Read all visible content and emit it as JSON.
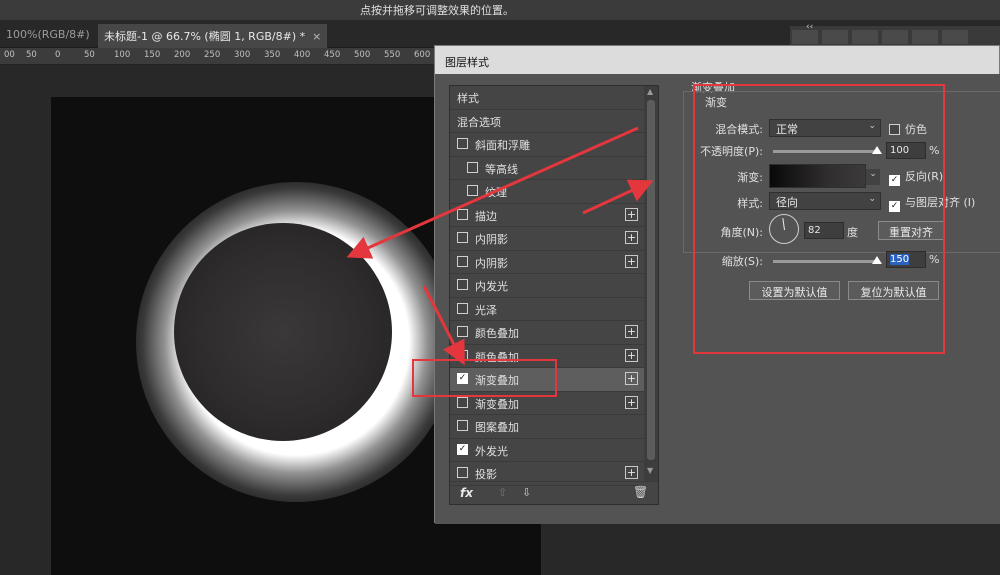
{
  "hint": "点按并拖移可调整效果的位置。",
  "panel_collapse_glyph": "‹‹",
  "tabs": [
    {
      "label": "100%(RGB/8#)",
      "close": "×"
    },
    {
      "label": "未标题-1 @ 66.7% (椭圆 1, RGB/8#) *",
      "close": "×"
    }
  ],
  "ruler": [
    "00",
    "50",
    "0",
    "50",
    "100",
    "150",
    "200",
    "250",
    "300",
    "350",
    "400",
    "450",
    "500",
    "550",
    "600",
    "650"
  ],
  "dialog": {
    "title": "图层样式",
    "style_list": [
      {
        "label": "样式",
        "checkbox": false,
        "checked": false,
        "plus": false,
        "indent": 0
      },
      {
        "label": "混合选项",
        "checkbox": false,
        "checked": false,
        "plus": false,
        "indent": 0
      },
      {
        "label": "斜面和浮雕",
        "checkbox": true,
        "checked": false,
        "plus": false,
        "indent": 0
      },
      {
        "label": "等高线",
        "checkbox": true,
        "checked": false,
        "plus": false,
        "indent": 1
      },
      {
        "label": "纹理",
        "checkbox": true,
        "checked": false,
        "plus": false,
        "indent": 1
      },
      {
        "label": "描边",
        "checkbox": true,
        "checked": false,
        "plus": true,
        "indent": 0
      },
      {
        "label": "内阴影",
        "checkbox": true,
        "checked": false,
        "plus": true,
        "indent": 0
      },
      {
        "label": "内阴影",
        "checkbox": true,
        "checked": false,
        "plus": true,
        "indent": 0
      },
      {
        "label": "内发光",
        "checkbox": true,
        "checked": false,
        "plus": false,
        "indent": 0
      },
      {
        "label": "光泽",
        "checkbox": true,
        "checked": false,
        "plus": false,
        "indent": 0
      },
      {
        "label": "颜色叠加",
        "checkbox": true,
        "checked": false,
        "plus": true,
        "indent": 0
      },
      {
        "label": "颜色叠加",
        "checkbox": true,
        "checked": false,
        "plus": true,
        "indent": 0
      },
      {
        "label": "渐变叠加",
        "checkbox": true,
        "checked": true,
        "plus": true,
        "indent": 0,
        "selected": true
      },
      {
        "label": "渐变叠加",
        "checkbox": true,
        "checked": false,
        "plus": true,
        "indent": 0
      },
      {
        "label": "图案叠加",
        "checkbox": true,
        "checked": false,
        "plus": false,
        "indent": 0
      },
      {
        "label": "外发光",
        "checkbox": true,
        "checked": true,
        "plus": false,
        "indent": 0
      },
      {
        "label": "投影",
        "checkbox": true,
        "checked": false,
        "plus": true,
        "indent": 0
      }
    ],
    "footer": {
      "fx": "fx",
      "up": "⇧",
      "down": "⇩",
      "trash": "🗑"
    },
    "section_title": "渐变叠加",
    "group_title": "渐变",
    "blend_mode": {
      "label": "混合模式:",
      "value": "正常"
    },
    "dither": {
      "label": "仿色",
      "checked": false
    },
    "opacity": {
      "label": "不透明度(P):",
      "value": "100",
      "unit": "%",
      "level": 1.0
    },
    "gradient": {
      "label": "渐变:"
    },
    "reverse": {
      "label": "反向(R)",
      "checked": true
    },
    "style": {
      "label": "样式:",
      "value": "径向"
    },
    "align": {
      "label": "与图层对齐 (I)",
      "checked": true
    },
    "angle": {
      "label": "角度(N):",
      "value": "82",
      "unit": "度"
    },
    "reset_align": "重置对齐",
    "scale": {
      "label": "缩放(S):",
      "value": "150",
      "unit": "%",
      "level": 1.0
    },
    "set_default": "设置为默认值",
    "reset_default": "复位为默认值"
  },
  "colors": {
    "annotation_red": "#e4373d",
    "glow": "#ffffff",
    "canvas": "#0f0e0e"
  }
}
